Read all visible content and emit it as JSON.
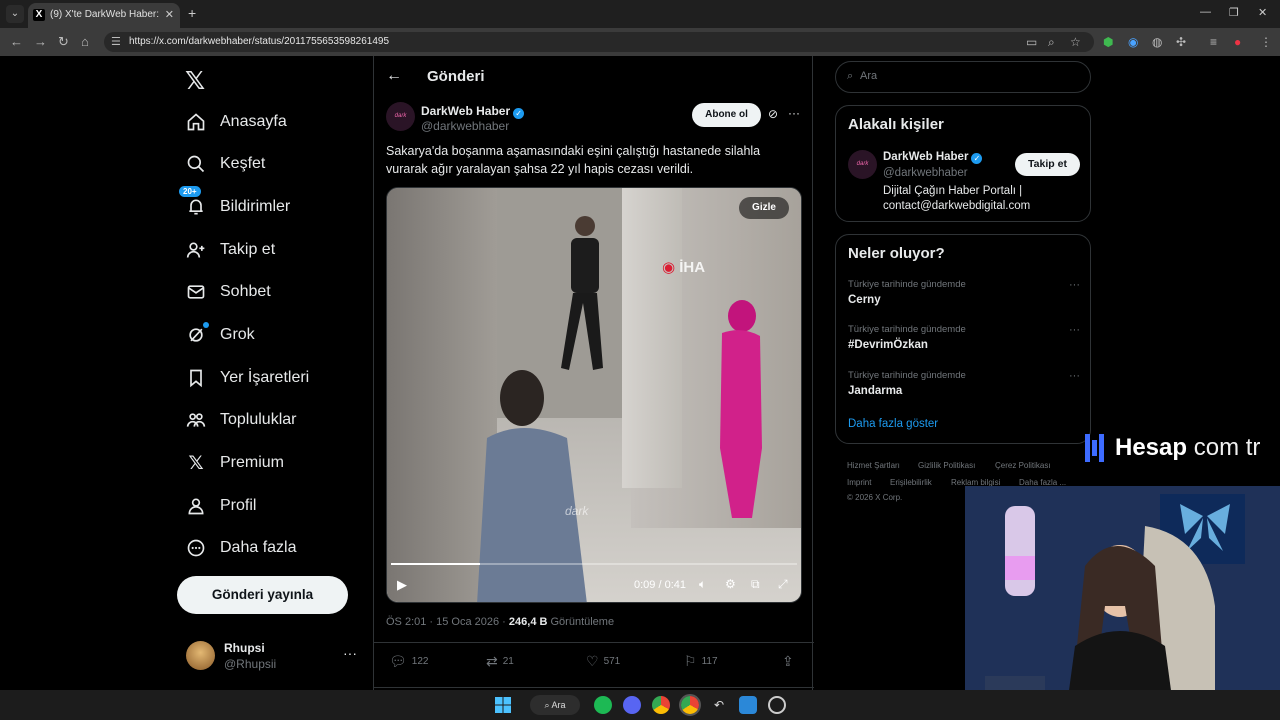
{
  "browser": {
    "tab_title": "(9) X'te DarkWeb Haber: \"Saka",
    "url": "https://x.com/darkwebhaber/status/2011755653598261495"
  },
  "sidebar": {
    "items": [
      {
        "label": "Anasayfa",
        "icon": "home-icon"
      },
      {
        "label": "Keşfet",
        "icon": "search-icon"
      },
      {
        "label": "Bildirimler",
        "icon": "bell-icon",
        "badge": "20+"
      },
      {
        "label": "Takip et",
        "icon": "add-person-icon"
      },
      {
        "label": "Sohbet",
        "icon": "mail-icon"
      },
      {
        "label": "Grok",
        "icon": "grok-icon"
      },
      {
        "label": "Yer İşaretleri",
        "icon": "bookmark-icon"
      },
      {
        "label": "Topluluklar",
        "icon": "communities-icon"
      },
      {
        "label": "Premium",
        "icon": "x-icon"
      },
      {
        "label": "Profil",
        "icon": "person-icon"
      },
      {
        "label": "Daha fazla",
        "icon": "more-circle-icon"
      }
    ],
    "post_button": "Gönderi yayınla",
    "user": {
      "name": "Rhupsi",
      "handle": "@Rhupsii"
    }
  },
  "post": {
    "header_title": "Gönderi",
    "author_name": "DarkWeb Haber",
    "author_handle": "@darkwebhaber",
    "avatar_text": "dark",
    "subscribe_label": "Abone ol",
    "text": "Sakarya'da boşanma aşamasındaki eşini çalıştığı hastanede silahla vurarak ağır yaralayan şahsa 22 yıl hapis cezası verildi.",
    "video": {
      "hide_label": "Gizle",
      "time": "0:09 / 0:41",
      "progress": 0.22,
      "watermark_iha": "İHA",
      "watermark_dark": "dark"
    },
    "meta": {
      "time": "ÖS 2:01 · 15 Oca 2026 · ",
      "views": "246,4 B",
      "views_label": " Görüntüleme"
    },
    "actions": {
      "replies": "122",
      "reposts": "21",
      "likes": "571",
      "bookmarks": "117"
    }
  },
  "right": {
    "search_placeholder": "Ara",
    "related": {
      "title": "Alakalı kişiler",
      "name": "DarkWeb Haber",
      "handle": "@darkwebhaber",
      "bio": "Dijital Çağın Haber Portalı | contact@darkwebdigital.com",
      "follow_label": "Takip et"
    },
    "trends": {
      "title": "Neler oluyor?",
      "items": [
        {
          "context": "Türkiye tarihinde gündemde",
          "name": "Cerny"
        },
        {
          "context": "Türkiye tarihinde gündemde",
          "name": "#DevrimÖzkan"
        },
        {
          "context": "Türkiye tarihinde gündemde",
          "name": "Jandarma"
        }
      ],
      "show_more": "Daha fazla göster"
    },
    "footer": [
      "Hizmet Şartları",
      "Gizlilik Politikası",
      "Çerez Politikası",
      "Imprint",
      "Erişilebilirlik",
      "Reklam bilgisi",
      "Daha fazla ...",
      "© 2026 X Corp."
    ]
  },
  "overlay": {
    "brand_main": "Hesap",
    "brand_suffix": "com tr"
  },
  "taskbar": {
    "search_label": "Ara"
  }
}
